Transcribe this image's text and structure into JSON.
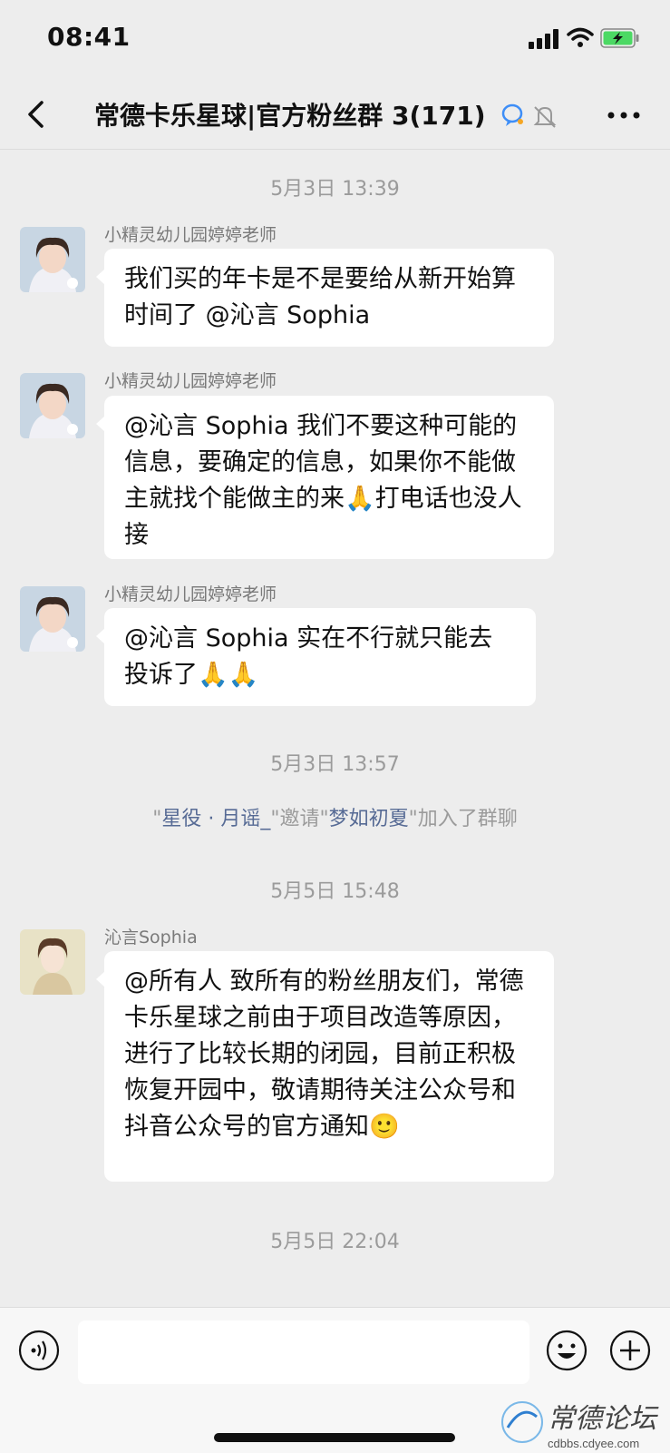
{
  "status_bar": {
    "time": "08:41"
  },
  "nav": {
    "title": "常德卡乐星球|官方粉丝群 3(171)",
    "back_icon": "chevron-left-icon",
    "more_icon": "ellipsis-icon"
  },
  "messages": [
    {
      "type": "time",
      "text": "5月3日 13:39"
    },
    {
      "type": "chat",
      "sender": "小精灵幼儿园婷婷老师",
      "text": "我们买的年卡是不是要给从新开始算时间了 @沁言 Sophia"
    },
    {
      "type": "chat",
      "sender": "小精灵幼儿园婷婷老师",
      "text": "@沁言 Sophia 我们不要这种可能的信息，要确定的信息，如果你不能做主就找个能做主的来🙏打电话也没人接"
    },
    {
      "type": "chat",
      "sender": "小精灵幼儿园婷婷老师",
      "text": "@沁言 Sophia 实在不行就只能去投诉了🙏🙏"
    },
    {
      "type": "time",
      "text": "5月3日 13:57"
    },
    {
      "type": "system",
      "q1": "\"",
      "name1": "星役 · 月谣_",
      "mid": "\"邀请\"",
      "name2": "梦如初夏",
      "end": "\"加入了群聊"
    },
    {
      "type": "time",
      "text": "5月5日 15:48"
    },
    {
      "type": "chat",
      "sender": "沁言Sophia",
      "text": "@所有人 致所有的粉丝朋友们，常德卡乐星球之前由于项目改造等原因，进行了比较长期的闭园，目前正积极恢复开园中，敬请期待关注公众号和抖音公众号的官方通知🙂"
    },
    {
      "type": "time",
      "text": "5月5日 22:04"
    }
  ],
  "watermark": {
    "brand": "常德论坛",
    "url": "cdbbs.cdyee.com"
  },
  "colors": {
    "background": "#ededed",
    "bubble": "#ffffff",
    "link": "#576b95",
    "muted": "#9b9b9b"
  }
}
